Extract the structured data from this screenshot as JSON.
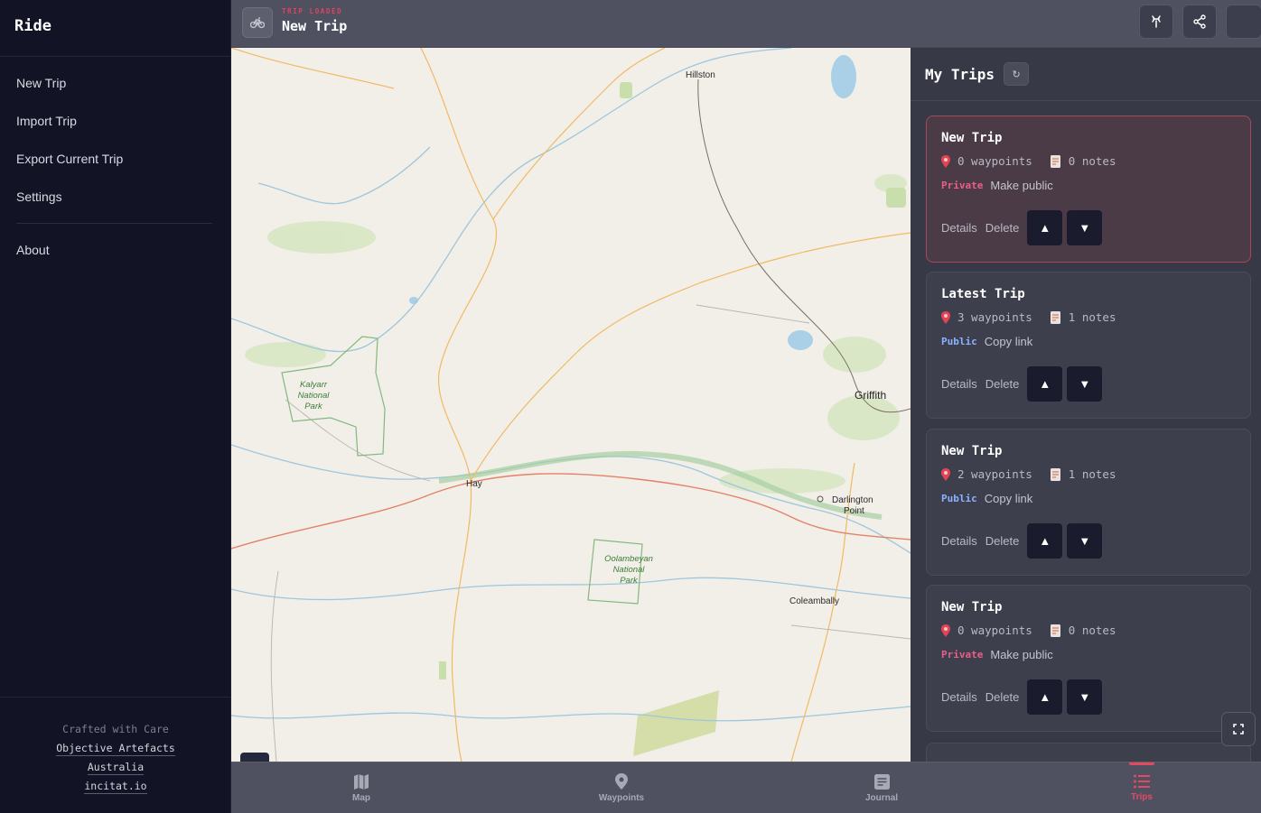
{
  "sidebar": {
    "brand": "Ride",
    "menu": [
      {
        "label": "New Trip"
      },
      {
        "label": "Import Trip"
      },
      {
        "label": "Export Current Trip"
      },
      {
        "label": "Settings"
      }
    ],
    "about": "About",
    "footer": {
      "crafted": "Crafted with Care",
      "links": [
        "Objective Artefacts",
        "Australia",
        "incitat.io"
      ]
    }
  },
  "topbar": {
    "eyebrow": "TRIP LOADED",
    "title": "New Trip",
    "icons": [
      "bicycle-icon",
      "route-icon",
      "share-icon"
    ]
  },
  "map": {
    "towns": [
      "Hillston",
      "Hay",
      "Griffith",
      "Darlington",
      "Point",
      "Coleambally"
    ],
    "parks": [
      {
        "lines": [
          "Kalyarr",
          "National",
          "Park"
        ]
      },
      {
        "lines": [
          "Oolambeyan",
          "National",
          "Park"
        ]
      }
    ]
  },
  "trips": {
    "title": "My Trips",
    "refresh_glyph": "↻",
    "details_label": "Details",
    "delete_label": "Delete",
    "up_glyph": "▲",
    "down_glyph": "▼",
    "items": [
      {
        "name": "New Trip",
        "waypoints": "0 waypoints",
        "notes": "0 notes",
        "visibility": "Private",
        "action": "Make public",
        "active": true
      },
      {
        "name": "Latest Trip",
        "waypoints": "3 waypoints",
        "notes": "1 notes",
        "visibility": "Public",
        "action": "Copy link",
        "active": false
      },
      {
        "name": "New Trip",
        "waypoints": "2 waypoints",
        "notes": "1 notes",
        "visibility": "Public",
        "action": "Copy link",
        "active": false
      },
      {
        "name": "New Trip",
        "waypoints": "0 waypoints",
        "notes": "0 notes",
        "visibility": "Private",
        "action": "Make public",
        "active": false
      }
    ]
  },
  "bottomnav": {
    "items": [
      {
        "label": "Map",
        "icon": "map-icon"
      },
      {
        "label": "Waypoints",
        "icon": "waypoint-pin-icon"
      },
      {
        "label": "Journal",
        "icon": "journal-icon"
      },
      {
        "label": "Trips",
        "icon": "trips-list-icon"
      }
    ],
    "active": "Trips"
  },
  "colors": {
    "accent": "#e34a5f",
    "sidebar_bg": "#121324",
    "panel_bg": "#373946",
    "private": "#ef5d8a",
    "public": "#8cb3ff"
  }
}
